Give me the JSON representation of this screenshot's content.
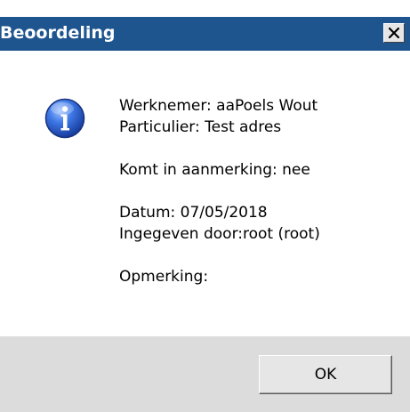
{
  "window": {
    "title": "Beoordeling"
  },
  "message": {
    "werknemer": "Werknemer: aaPoels Wout",
    "particulier": "Particulier: Test adres",
    "komt_in_aanmerking": "Komt in aanmerking: nee",
    "datum": "Datum: 07/05/2018",
    "ingegeven_door": "Ingegeven door:root (root)",
    "opmerking": "Opmerking:"
  },
  "buttons": {
    "ok_label": "OK"
  },
  "icons": {
    "close": "close-icon",
    "info": "info-icon"
  },
  "colors": {
    "titlebar": "#1f558f",
    "footer": "#dcdcdc",
    "button": "#e6e6e6",
    "icon_blue": "#2a5bd0"
  }
}
